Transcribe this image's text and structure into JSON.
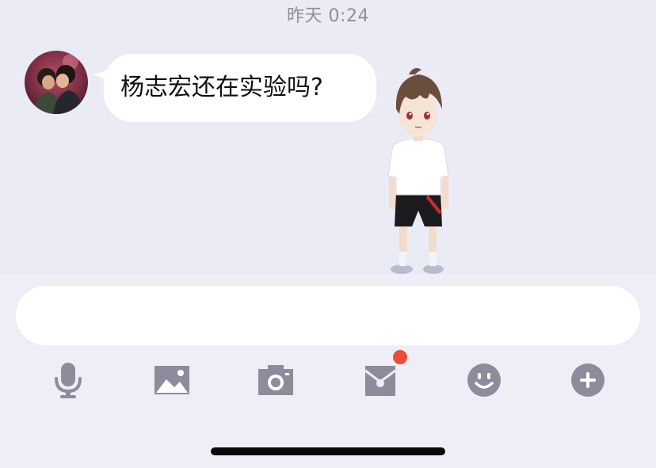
{
  "timestamp": "昨天 0:24",
  "message": {
    "text": "杨志宏还在实验吗?"
  },
  "input": {
    "value": "",
    "placeholder": ""
  },
  "toolbar": {
    "icons": [
      "microphone-icon",
      "image-icon",
      "camera-icon",
      "red-packet-icon",
      "emoji-icon",
      "plus-icon"
    ],
    "icon_color": "#8c8c9c",
    "badge_color": "#ef4a38"
  },
  "colors": {
    "chat_background": "#ebebf5",
    "panel_background": "#eeeef6",
    "bubble": "#ffffff"
  }
}
